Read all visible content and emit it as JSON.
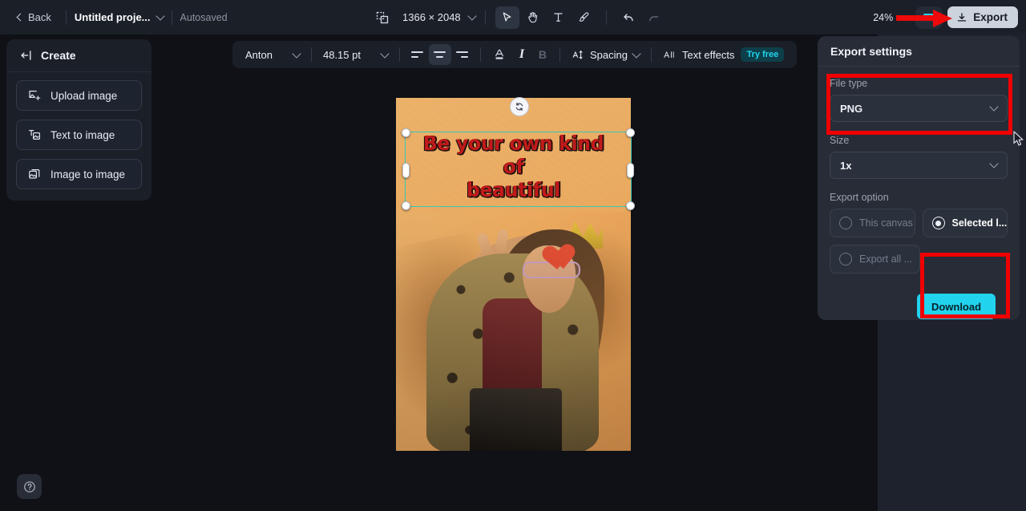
{
  "topbar": {
    "back_label": "Back",
    "project_title": "Untitled proje...",
    "autosaved_label": "Autosaved",
    "canvas_size": "1366 × 2048",
    "zoom_level": "24%",
    "export_label": "Export",
    "tools": [
      {
        "name": "resize-icon",
        "title": "Resize"
      },
      {
        "name": "select-tool-icon",
        "title": "Select"
      },
      {
        "name": "hand-tool-icon",
        "title": "Hand"
      },
      {
        "name": "text-tool-icon",
        "title": "Text"
      },
      {
        "name": "brush-tool-icon",
        "title": "Brush"
      },
      {
        "name": "undo-icon",
        "title": "Undo"
      },
      {
        "name": "redo-icon",
        "title": "Redo"
      }
    ]
  },
  "sidebar": {
    "header": "Create",
    "items": [
      {
        "label": "Upload image",
        "icon": "upload-image-icon"
      },
      {
        "label": "Text to image",
        "icon": "text-to-image-icon"
      },
      {
        "label": "Image to image",
        "icon": "image-to-image-icon"
      }
    ]
  },
  "text_toolbar": {
    "font_family": "Anton",
    "font_size": "48.15 pt",
    "align_left": "Align left",
    "align_center": "Align center",
    "align_right": "Align right",
    "text_color": "Text color",
    "italic": "I",
    "bold": "B",
    "spacing_label": "Spacing",
    "text_effects_label": "Text effects",
    "try_free_badge": "Try free"
  },
  "canvas": {
    "headline_line1": "Be your own kind of",
    "headline_line2": "beautiful",
    "headline_color": "#c01a1a",
    "background_color": "#eeac5f",
    "selection_color": "#35c8b8"
  },
  "export_panel": {
    "title": "Export settings",
    "file_type_label": "File type",
    "file_type_value": "PNG",
    "size_label": "Size",
    "size_value": "1x",
    "export_option_label": "Export option",
    "options": [
      {
        "label": "This canvas",
        "selected": false
      },
      {
        "label": "Selected l...",
        "selected": true
      },
      {
        "label": "Export all ...",
        "selected": false
      }
    ],
    "download_label": "Download",
    "accent_color": "#22d3ee"
  },
  "annotations": {
    "highlight_color": "#ef0000",
    "arrow_target": "Export",
    "box_filetype_target": "File type",
    "box_download_target": "Download"
  },
  "help": {
    "label": "?"
  }
}
